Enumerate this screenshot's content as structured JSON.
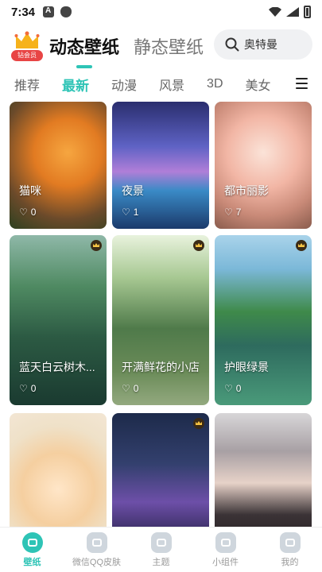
{
  "status_bar": {
    "time": "7:34"
  },
  "header": {
    "vip_label": "钻会员",
    "tab_dynamic": "动态壁纸",
    "tab_static": "静态壁纸",
    "search_placeholder": "奥特曼"
  },
  "categories": [
    "推荐",
    "最新",
    "动漫",
    "风景",
    "3D",
    "美女"
  ],
  "active_category": "最新",
  "wallpapers": [
    {
      "title": "猫咪",
      "likes": "0",
      "vip": false
    },
    {
      "title": "夜景",
      "likes": "1",
      "vip": false
    },
    {
      "title": "都市丽影",
      "likes": "7",
      "vip": false
    },
    {
      "title": "蓝天白云树木...",
      "likes": "0",
      "vip": true
    },
    {
      "title": "开满鲜花的小店",
      "likes": "0",
      "vip": true
    },
    {
      "title": "护眼绿景",
      "likes": "0",
      "vip": true
    },
    {
      "title": "",
      "likes": "",
      "vip": false
    },
    {
      "title": "",
      "likes": "",
      "vip": true
    },
    {
      "title": "",
      "likes": "",
      "vip": false
    }
  ],
  "bottom_nav": [
    {
      "label": "壁纸",
      "active": true
    },
    {
      "label": "微信QQ皮肤",
      "active": false
    },
    {
      "label": "主题",
      "active": false
    },
    {
      "label": "小组件",
      "active": false
    },
    {
      "label": "我的",
      "active": false
    }
  ],
  "colors": {
    "accent": "#2ec4b6",
    "vip_red": "#e84545"
  }
}
